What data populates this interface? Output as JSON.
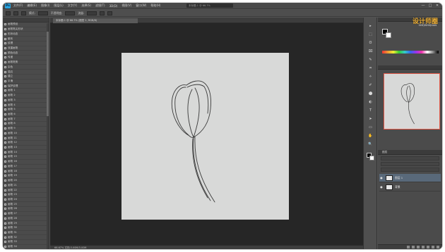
{
  "app": {
    "logo": "Ps"
  },
  "menu": [
    "文件(F)",
    "编辑(E)",
    "图像(I)",
    "图层(L)",
    "文字(Y)",
    "选择(S)",
    "滤镜(T)",
    "3D(D)",
    "视图(V)",
    "窗口(W)",
    "帮助(H)"
  ],
  "window": {
    "document_title": "未标题-1 @ 66.7%",
    "controls": [
      "—",
      "□",
      "✕"
    ]
  },
  "options_bar": {
    "labels": [
      "模式:",
      "不透明度:",
      "流量:"
    ]
  },
  "workspace": {
    "tab": "未标题-1 @ 66.7% (图层 1, RGB/8)",
    "status": "66.67%  文档:3.00M/3.00M"
  },
  "left_panel": {
    "items": [
      "画笔预设",
      "画笔笔尖形状",
      "形状动态",
      "散布",
      "纹理",
      "双重画笔",
      "颜色动态",
      "传递",
      "画笔笔势",
      "杂色",
      "湿边",
      "建立",
      "平滑",
      "保护纹理",
      "画笔 1",
      "画笔 2",
      "画笔 3",
      "画笔 4",
      "画笔 5",
      "画笔 6",
      "画笔 7",
      "画笔 8",
      "画笔 9",
      "画笔 10",
      "画笔 11",
      "画笔 12",
      "画笔 13",
      "画笔 14",
      "画笔 15",
      "画笔 16",
      "画笔 17",
      "画笔 18",
      "画笔 19",
      "画笔 20",
      "画笔 21",
      "画笔 22",
      "画笔 23",
      "画笔 24",
      "画笔 25",
      "画笔 26",
      "画笔 27",
      "画笔 28",
      "画笔 29",
      "画笔 30",
      "画笔 31",
      "画笔 32",
      "画笔 33",
      "画笔 34",
      "画笔 35"
    ]
  },
  "tools": [
    "▸",
    "⬚",
    "ʘ",
    "⌧",
    "✎",
    "⌗",
    "✧",
    "✐",
    "⬤",
    "◐",
    "T",
    "➤",
    "▭",
    "✋",
    "🔍"
  ],
  "right_panel": {
    "watermark": "设计师圈",
    "watermark_sub": "SHEJISHIQUAN",
    "layers_title": "图层",
    "layers": [
      {
        "name": "图层 1",
        "active": true
      },
      {
        "name": "背景",
        "active": false
      }
    ]
  },
  "colors": {
    "accent_nav_frame": "#e35a4a",
    "active_layer": "#59697a"
  }
}
